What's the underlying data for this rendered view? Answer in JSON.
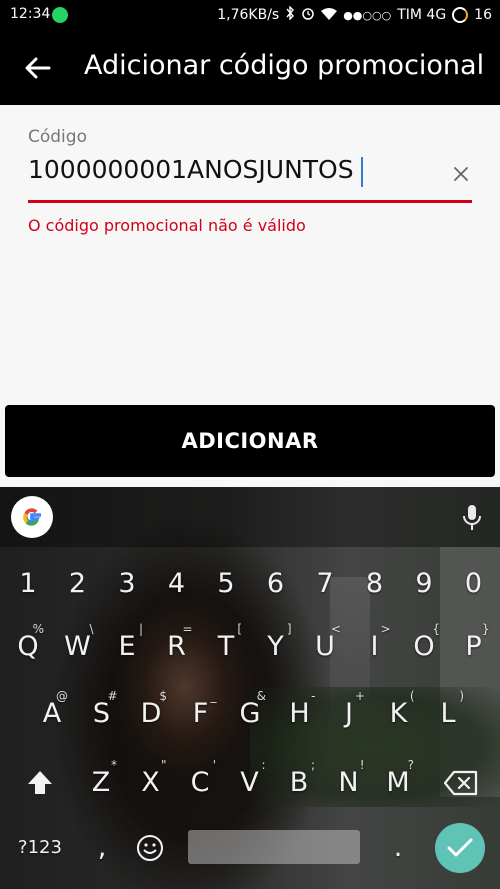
{
  "status_bar": {
    "time": "12:34",
    "network_speed": "1,76KB/s",
    "carrier": "TIM 4G",
    "battery": "16",
    "signal_dots": "●●○○○"
  },
  "app_bar": {
    "title": "Adicionar código promocional",
    "back_icon": "arrow-left-icon"
  },
  "form": {
    "label": "Código",
    "value": "1000000001ANOSJUNTOS",
    "error": "O código promocional não é válido",
    "clear_icon": "close-icon",
    "error_color": "#d0021b"
  },
  "submit_label": "ADICIONAR",
  "keyboard": {
    "google_label": "G",
    "numbers": [
      "1",
      "2",
      "3",
      "4",
      "5",
      "6",
      "7",
      "8",
      "9",
      "0"
    ],
    "row1": [
      {
        "k": "Q",
        "h": "%"
      },
      {
        "k": "W",
        "h": "\\"
      },
      {
        "k": "E",
        "h": "|"
      },
      {
        "k": "R",
        "h": "="
      },
      {
        "k": "T",
        "h": "["
      },
      {
        "k": "Y",
        "h": "]"
      },
      {
        "k": "U",
        "h": "<"
      },
      {
        "k": "I",
        "h": ">"
      },
      {
        "k": "O",
        "h": "{"
      },
      {
        "k": "P",
        "h": "}"
      }
    ],
    "row2": [
      {
        "k": "A",
        "h": "@"
      },
      {
        "k": "S",
        "h": "#"
      },
      {
        "k": "D",
        "h": "$"
      },
      {
        "k": "F",
        "h": "_"
      },
      {
        "k": "G",
        "h": "&"
      },
      {
        "k": "H",
        "h": "-"
      },
      {
        "k": "J",
        "h": "+"
      },
      {
        "k": "K",
        "h": "("
      },
      {
        "k": "L",
        "h": ")"
      }
    ],
    "row3": [
      {
        "k": "Z",
        "h": "*"
      },
      {
        "k": "X",
        "h": "\""
      },
      {
        "k": "C",
        "h": "'"
      },
      {
        "k": "V",
        "h": ":"
      },
      {
        "k": "B",
        "h": ";"
      },
      {
        "k": "N",
        "h": "!"
      },
      {
        "k": "M",
        "h": "?"
      }
    ],
    "symbols_label": "?123",
    "comma": ",",
    "emoji_icon": "smiley-icon",
    "period": ".",
    "shift_icon": "shift-icon",
    "backspace_icon": "backspace-icon",
    "enter_icon": "check-icon",
    "mic_icon": "microphone-icon"
  }
}
